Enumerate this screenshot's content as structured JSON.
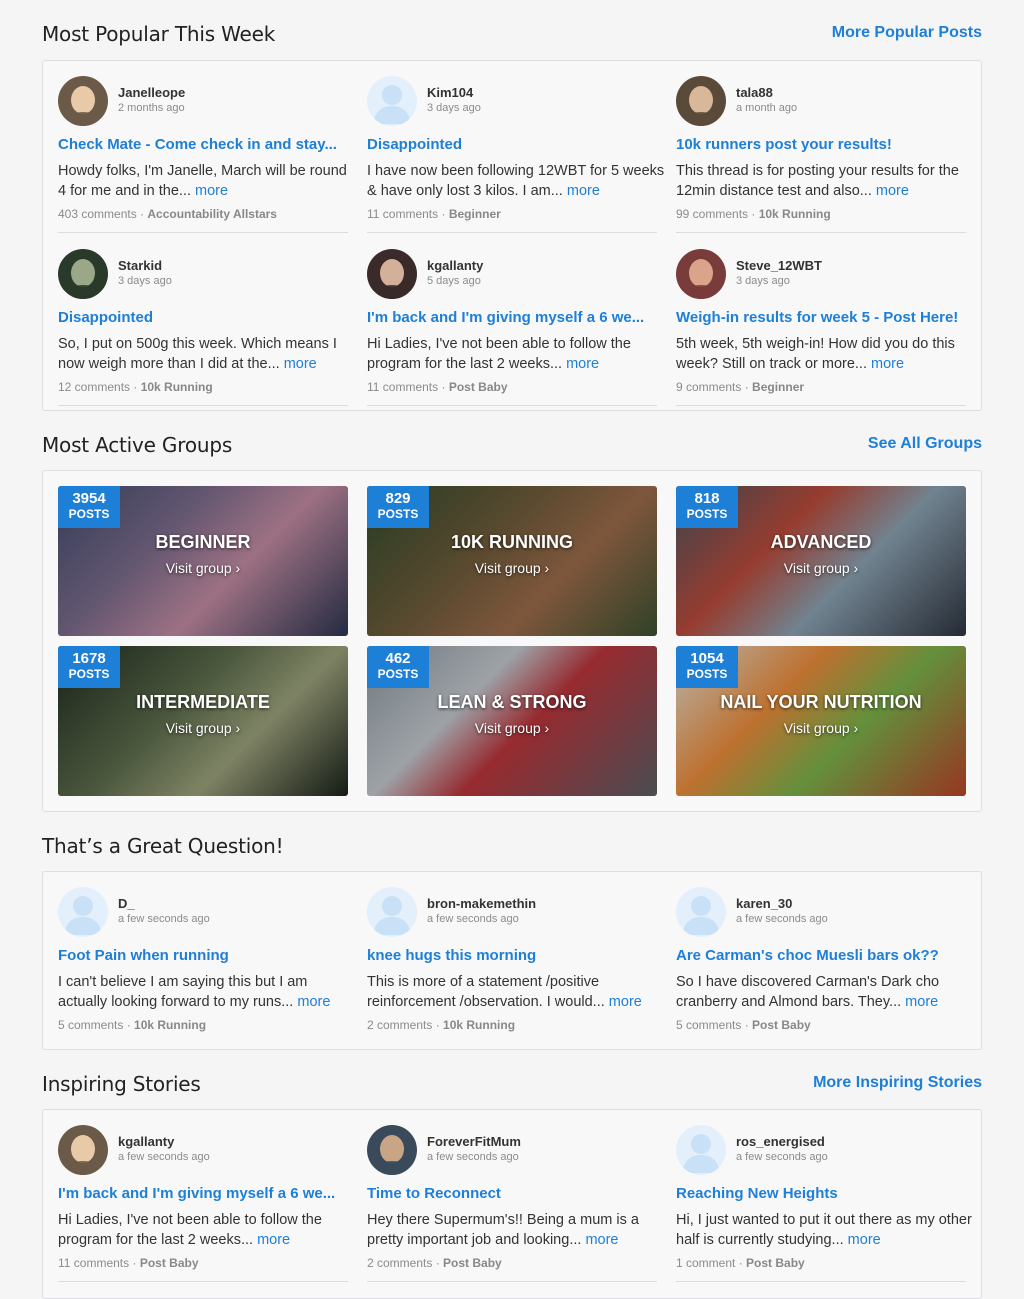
{
  "popular": {
    "title": "Most Popular This Week",
    "link": "More Popular Posts",
    "posts": [
      {
        "user": "Janelleope",
        "time": "2 months ago",
        "title": "Check Mate - Come check in and stay...",
        "body": "Howdy folks, I'm Janelle, March will be round 4 for me and in the...",
        "more": "more",
        "comments": "403 comments",
        "group": "Accountability Allstars",
        "avatar": "photo"
      },
      {
        "user": "Kim104",
        "time": "3 days ago",
        "title": "Disappointed",
        "body": "I have now been following 12WBT for 5 weeks & have only lost 3 kilos. I am...",
        "more": "more",
        "comments": "11 comments",
        "group": "Beginner",
        "avatar": "blank"
      },
      {
        "user": "tala88",
        "time": "a month ago",
        "title": "10k runners post your results!",
        "body": "This thread is for posting your results for the 12min distance test and also...",
        "more": "more",
        "comments": "99 comments",
        "group": "10k Running",
        "avatar": "photo"
      },
      {
        "user": "Starkid",
        "time": "3 days ago",
        "title": "Disappointed",
        "body": "So, I put on 500g this week. Which means I now weigh more than I did at the...",
        "more": "more",
        "comments": "12 comments",
        "group": "10k Running",
        "avatar": "photo"
      },
      {
        "user": "kgallanty",
        "time": "5 days ago",
        "title": "I'm back and I'm giving myself a 6 we...",
        "body": "Hi Ladies, I've not been able to follow the program for the last 2 weeks...",
        "more": "more",
        "comments": "11 comments",
        "group": "Post Baby",
        "avatar": "photo"
      },
      {
        "user": "Steve_12WBT",
        "time": "3 days ago",
        "title": "Weigh-in results for week 5 - Post Here!",
        "body": "5th week, 5th weigh-in! How did you do this week? Still on track or more...",
        "more": "more",
        "comments": "9 comments",
        "group": "Beginner",
        "avatar": "photo"
      }
    ]
  },
  "groups": {
    "title": "Most Active Groups",
    "link": "See All Groups",
    "visit_label": "Visit group ›",
    "posts_label": "POSTS",
    "items": [
      {
        "count": "3954",
        "name": "BEGINNER"
      },
      {
        "count": "829",
        "name": "10K RUNNING"
      },
      {
        "count": "818",
        "name": "ADVANCED"
      },
      {
        "count": "1678",
        "name": "INTERMEDIATE"
      },
      {
        "count": "462",
        "name": "LEAN & STRONG"
      },
      {
        "count": "1054",
        "name": "NAIL YOUR NUTRITION"
      }
    ]
  },
  "questions": {
    "title": "That’s a Great Question!",
    "posts": [
      {
        "user": "D_",
        "time": "a few seconds ago",
        "title": "Foot Pain when running",
        "body": "I can't believe I am saying this but I am actually looking forward to my runs...",
        "more": "more",
        "comments": "5 comments",
        "group": "10k Running",
        "avatar": "blank"
      },
      {
        "user": "bron-makemethin",
        "time": "a few seconds ago",
        "title": "knee hugs this morning",
        "body": "This is more of a statement /positive reinforcement /observation. I would...",
        "more": "more",
        "comments": "2 comments",
        "group": "10k Running",
        "avatar": "blank"
      },
      {
        "user": "karen_30",
        "time": "a few seconds ago",
        "title": "Are Carman's choc Muesli bars ok??",
        "body": "So I have discovered Carman's Dark cho cranberry and Almond bars. They...",
        "more": "more",
        "comments": "5 comments",
        "group": "Post Baby",
        "avatar": "blank"
      }
    ]
  },
  "stories": {
    "title": "Inspiring Stories",
    "link": "More Inspiring Stories",
    "posts": [
      {
        "user": "kgallanty",
        "time": "a few seconds ago",
        "title": "I'm back and I'm giving myself a 6 we...",
        "body": "Hi Ladies, I've not been able to follow the program for the last 2 weeks...",
        "more": "more",
        "comments": "11 comments",
        "group": "Post Baby",
        "avatar": "photo"
      },
      {
        "user": "ForeverFitMum",
        "time": "a few seconds ago",
        "title": "Time to Reconnect",
        "body": "Hey there Supermum's!! Being a mum is a pretty important job and looking...",
        "more": "more",
        "comments": "2 comments",
        "group": "Post Baby",
        "avatar": "photo"
      },
      {
        "user": "ros_energised",
        "time": "a few seconds ago",
        "title": "Reaching New Heights",
        "body": "Hi, I just wanted to put it out there as my other half is currently studying...",
        "more": "more",
        "comments": "1 comment",
        "group": "Post Baby",
        "avatar": "blank"
      }
    ]
  },
  "separator": " · ",
  "colors": {
    "accent": "#1e7fd6",
    "background": "#f5f5f6",
    "card": "#f8f8f9"
  }
}
